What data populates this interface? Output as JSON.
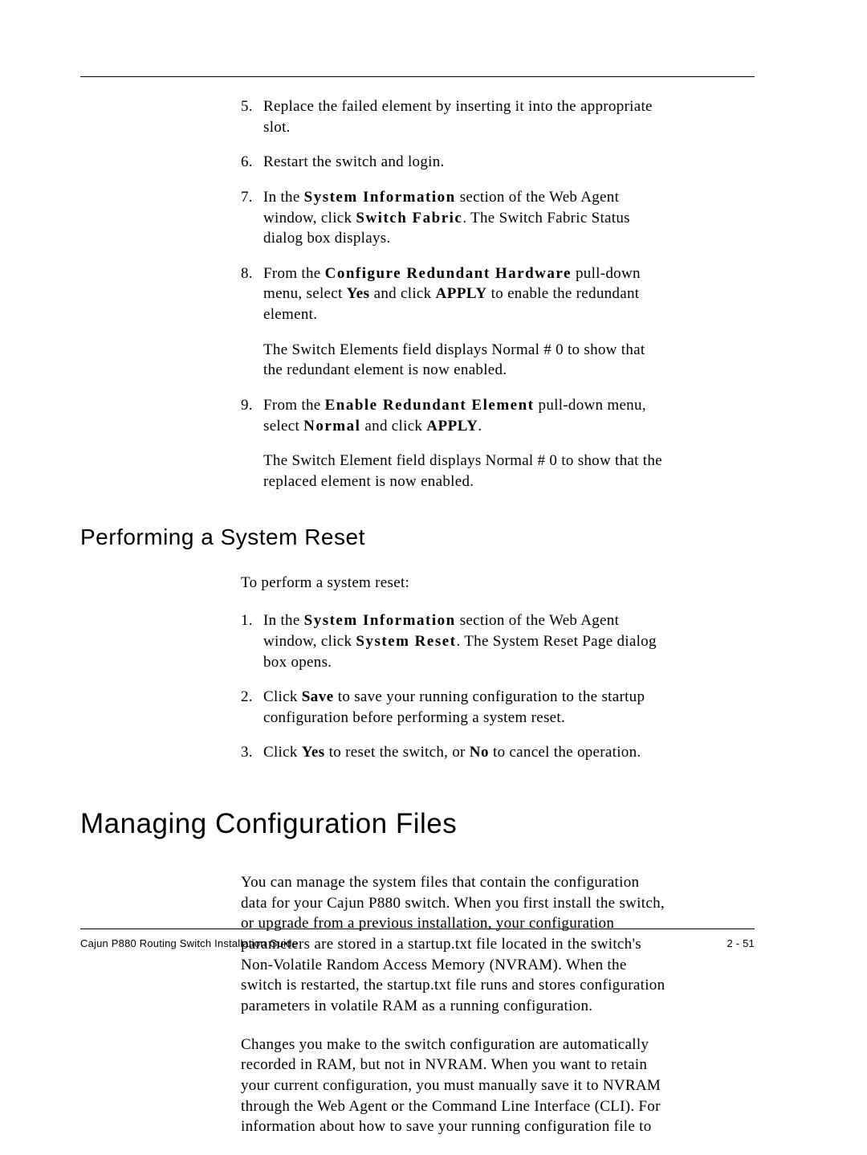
{
  "steps_a": [
    {
      "n": "5.",
      "runs": [
        [
          {
            "t": "Replace the failed element by inserting it into the appropriate slot."
          }
        ]
      ]
    },
    {
      "n": "6.",
      "runs": [
        [
          {
            "t": "Restart the switch and login."
          }
        ]
      ]
    },
    {
      "n": "7.",
      "runs": [
        [
          {
            "t": "In the "
          },
          {
            "t": "System Information",
            "cls": "b"
          },
          {
            "t": " section of the Web Agent window, click "
          },
          {
            "t": "Switch Fabric",
            "cls": "b"
          },
          {
            "t": ". The Switch Fabric Status dialog box displays."
          }
        ]
      ]
    },
    {
      "n": "8.",
      "runs": [
        [
          {
            "t": "From the "
          },
          {
            "t": "Configure Redundant Hardware",
            "cls": "b"
          },
          {
            "t": " pull-down menu, select "
          },
          {
            "t": "Yes",
            "cls": "b-tight"
          },
          {
            "t": " and click "
          },
          {
            "t": "APPLY",
            "cls": "b-tight"
          },
          {
            "t": " to enable the redundant element."
          }
        ],
        [
          {
            "t": "The Switch Elements field displays Normal # 0 to show that the redundant element is now enabled."
          }
        ]
      ]
    },
    {
      "n": "9.",
      "runs": [
        [
          {
            "t": "From the "
          },
          {
            "t": "Enable Redundant Element",
            "cls": "b"
          },
          {
            "t": " pull-down menu, select "
          },
          {
            "t": "Normal",
            "cls": "b"
          },
          {
            "t": " and click "
          },
          {
            "t": "APPLY",
            "cls": "b-tight"
          },
          {
            "t": "."
          }
        ],
        [
          {
            "t": "The Switch Element field displays Normal # 0 to show that the replaced element is now enabled."
          }
        ]
      ]
    }
  ],
  "section_reset": {
    "heading": "Performing a System Reset",
    "intro": "To perform a system reset:",
    "steps": [
      {
        "n": "1.",
        "runs": [
          [
            {
              "t": "In the "
            },
            {
              "t": "System Information",
              "cls": "b"
            },
            {
              "t": " section of the Web Agent window, click "
            },
            {
              "t": "System Reset",
              "cls": "b"
            },
            {
              "t": ". The System Reset Page dialog box opens."
            }
          ]
        ]
      },
      {
        "n": "2.",
        "runs": [
          [
            {
              "t": "Click "
            },
            {
              "t": "Save",
              "cls": "b-tight"
            },
            {
              "t": " to save your running configuration to the startup configuration before performing a system reset."
            }
          ]
        ]
      },
      {
        "n": "3.",
        "runs": [
          [
            {
              "t": "Click "
            },
            {
              "t": "Yes",
              "cls": "b-tight"
            },
            {
              "t": " to reset the switch, or "
            },
            {
              "t": "No",
              "cls": "b-tight"
            },
            {
              "t": " to cancel the operation."
            }
          ]
        ]
      }
    ]
  },
  "section_files": {
    "heading": "Managing Configuration Files",
    "paras": [
      "You can manage the system files that contain the configuration data for your Cajun P880 switch. When you first install the switch, or upgrade from a previous installation, your configuration parameters are stored in a startup.txt file located in the switch's Non-Volatile Random Access Memory (NVRAM). When the switch is restarted, the startup.txt file runs and stores configuration parameters in volatile RAM as a running configuration.",
      "Changes you make to the switch configuration are automatically recorded in RAM, but not in NVRAM. When you want to retain your current configuration, you must manually save it to NVRAM through the Web Agent or the Command Line Interface (CLI). For information about how to save your running configuration file to"
    ]
  },
  "footer": {
    "guide": "Cajun P880 Routing Switch Installation Guide",
    "page": "2 - 51"
  }
}
